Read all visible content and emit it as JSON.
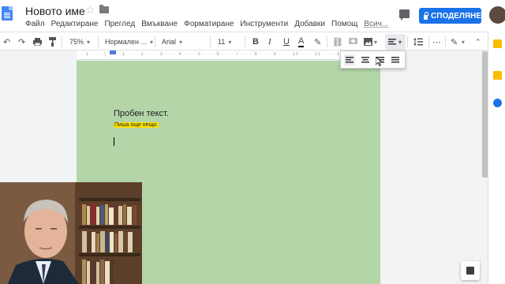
{
  "header": {
    "doc_title": "Новото име",
    "share_label": "СПОДЕЛЯНЕ",
    "menu": [
      "Файл",
      "Редактиране",
      "Преглед",
      "Вмъкване",
      "Форматиране",
      "Инструменти",
      "Добавки",
      "Помощ",
      "Всич..."
    ]
  },
  "toolbar": {
    "zoom": "75%",
    "style": "Нормален ...",
    "font": "Arial",
    "font_size": "11",
    "bold": "B",
    "italic": "I",
    "underline": "U",
    "text_color": "A"
  },
  "document": {
    "line1": "Пробен текст.",
    "line2": "Пиша още нещо.",
    "page_color": "#b3d5a8",
    "highlight_color": "#ffe100"
  },
  "colors": {
    "accent": "#1a73e8"
  }
}
